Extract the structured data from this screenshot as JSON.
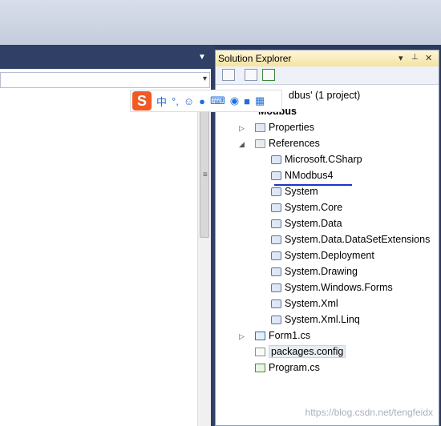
{
  "solution_explorer": {
    "title": "Solution Explorer",
    "controls": {
      "dropdown": "▾",
      "pin": "📌",
      "close": "✕"
    },
    "solution_label": "dbus' (1 project)",
    "project_label": "Modbus",
    "items": [
      {
        "label": "Properties"
      },
      {
        "label": "References"
      },
      {
        "label": "Microsoft.CSharp"
      },
      {
        "label": "NModbus4"
      },
      {
        "label": "System"
      },
      {
        "label": "System.Core"
      },
      {
        "label": "System.Data"
      },
      {
        "label": "System.Data.DataSetExtensions"
      },
      {
        "label": "System.Deployment"
      },
      {
        "label": "System.Drawing"
      },
      {
        "label": "System.Windows.Forms"
      },
      {
        "label": "System.Xml"
      },
      {
        "label": "System.Xml.Linq"
      },
      {
        "label": "Form1.cs"
      },
      {
        "label": "packages.config"
      },
      {
        "label": "Program.cs"
      }
    ]
  },
  "ime_toolbar": {
    "logo": "S",
    "glyphs": [
      "中",
      "°,",
      "☺",
      "🎤",
      "⌨",
      "👤",
      "👕",
      "▦"
    ]
  },
  "watermark": "https://blog.csdn.net/tengfeidx",
  "colors": {
    "highlight_underline": "#1d33c8",
    "ime_logo": "#f15a24"
  }
}
